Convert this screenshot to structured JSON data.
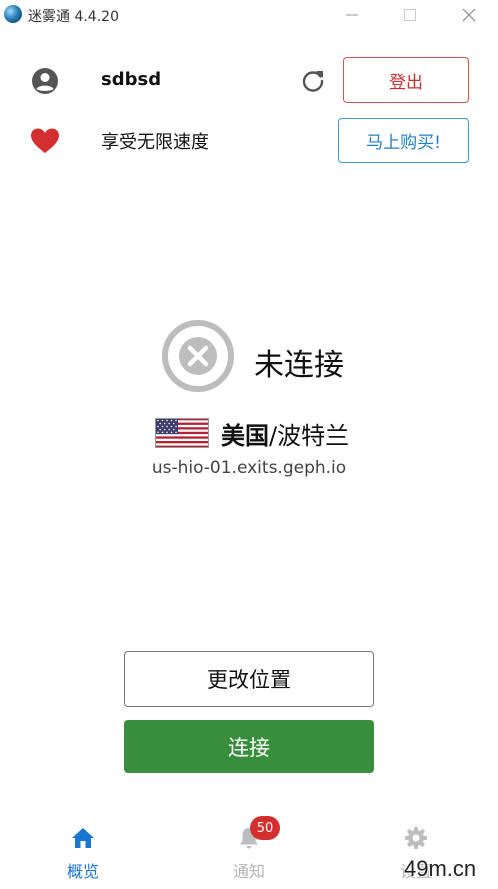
{
  "window": {
    "title": "迷雾通 4.4.20"
  },
  "account": {
    "username": "sdbsd",
    "logout_label": "登出"
  },
  "promo": {
    "text": "享受无限速度",
    "buy_label": "马上购买!"
  },
  "status": {
    "state_text": "未连接",
    "country": "美国",
    "separator_city": "/波特兰",
    "server": "us-hio-01.exits.geph.io"
  },
  "actions": {
    "change_location_label": "更改位置",
    "connect_label": "连接"
  },
  "nav": {
    "overview_label": "概览",
    "notifications_label": "通知",
    "notifications_badge": "50",
    "settings_label": "设置"
  },
  "watermark": "49m.cn",
  "colors": {
    "logout_red": "#c9302c",
    "buy_blue": "#1f7fc4",
    "connect_green": "#388e3c",
    "active_nav_blue": "#1976d2",
    "badge_red": "#d32f2f",
    "heart_red": "#d32f2f"
  },
  "icons": {
    "app": "app-logo-icon",
    "user": "account-circle-icon",
    "refresh": "refresh-icon",
    "heart": "heart-icon",
    "status": "disconnected-x-icon",
    "flag": "us-flag-icon",
    "home": "home-icon",
    "bell": "bell-icon",
    "gear": "gear-icon"
  }
}
